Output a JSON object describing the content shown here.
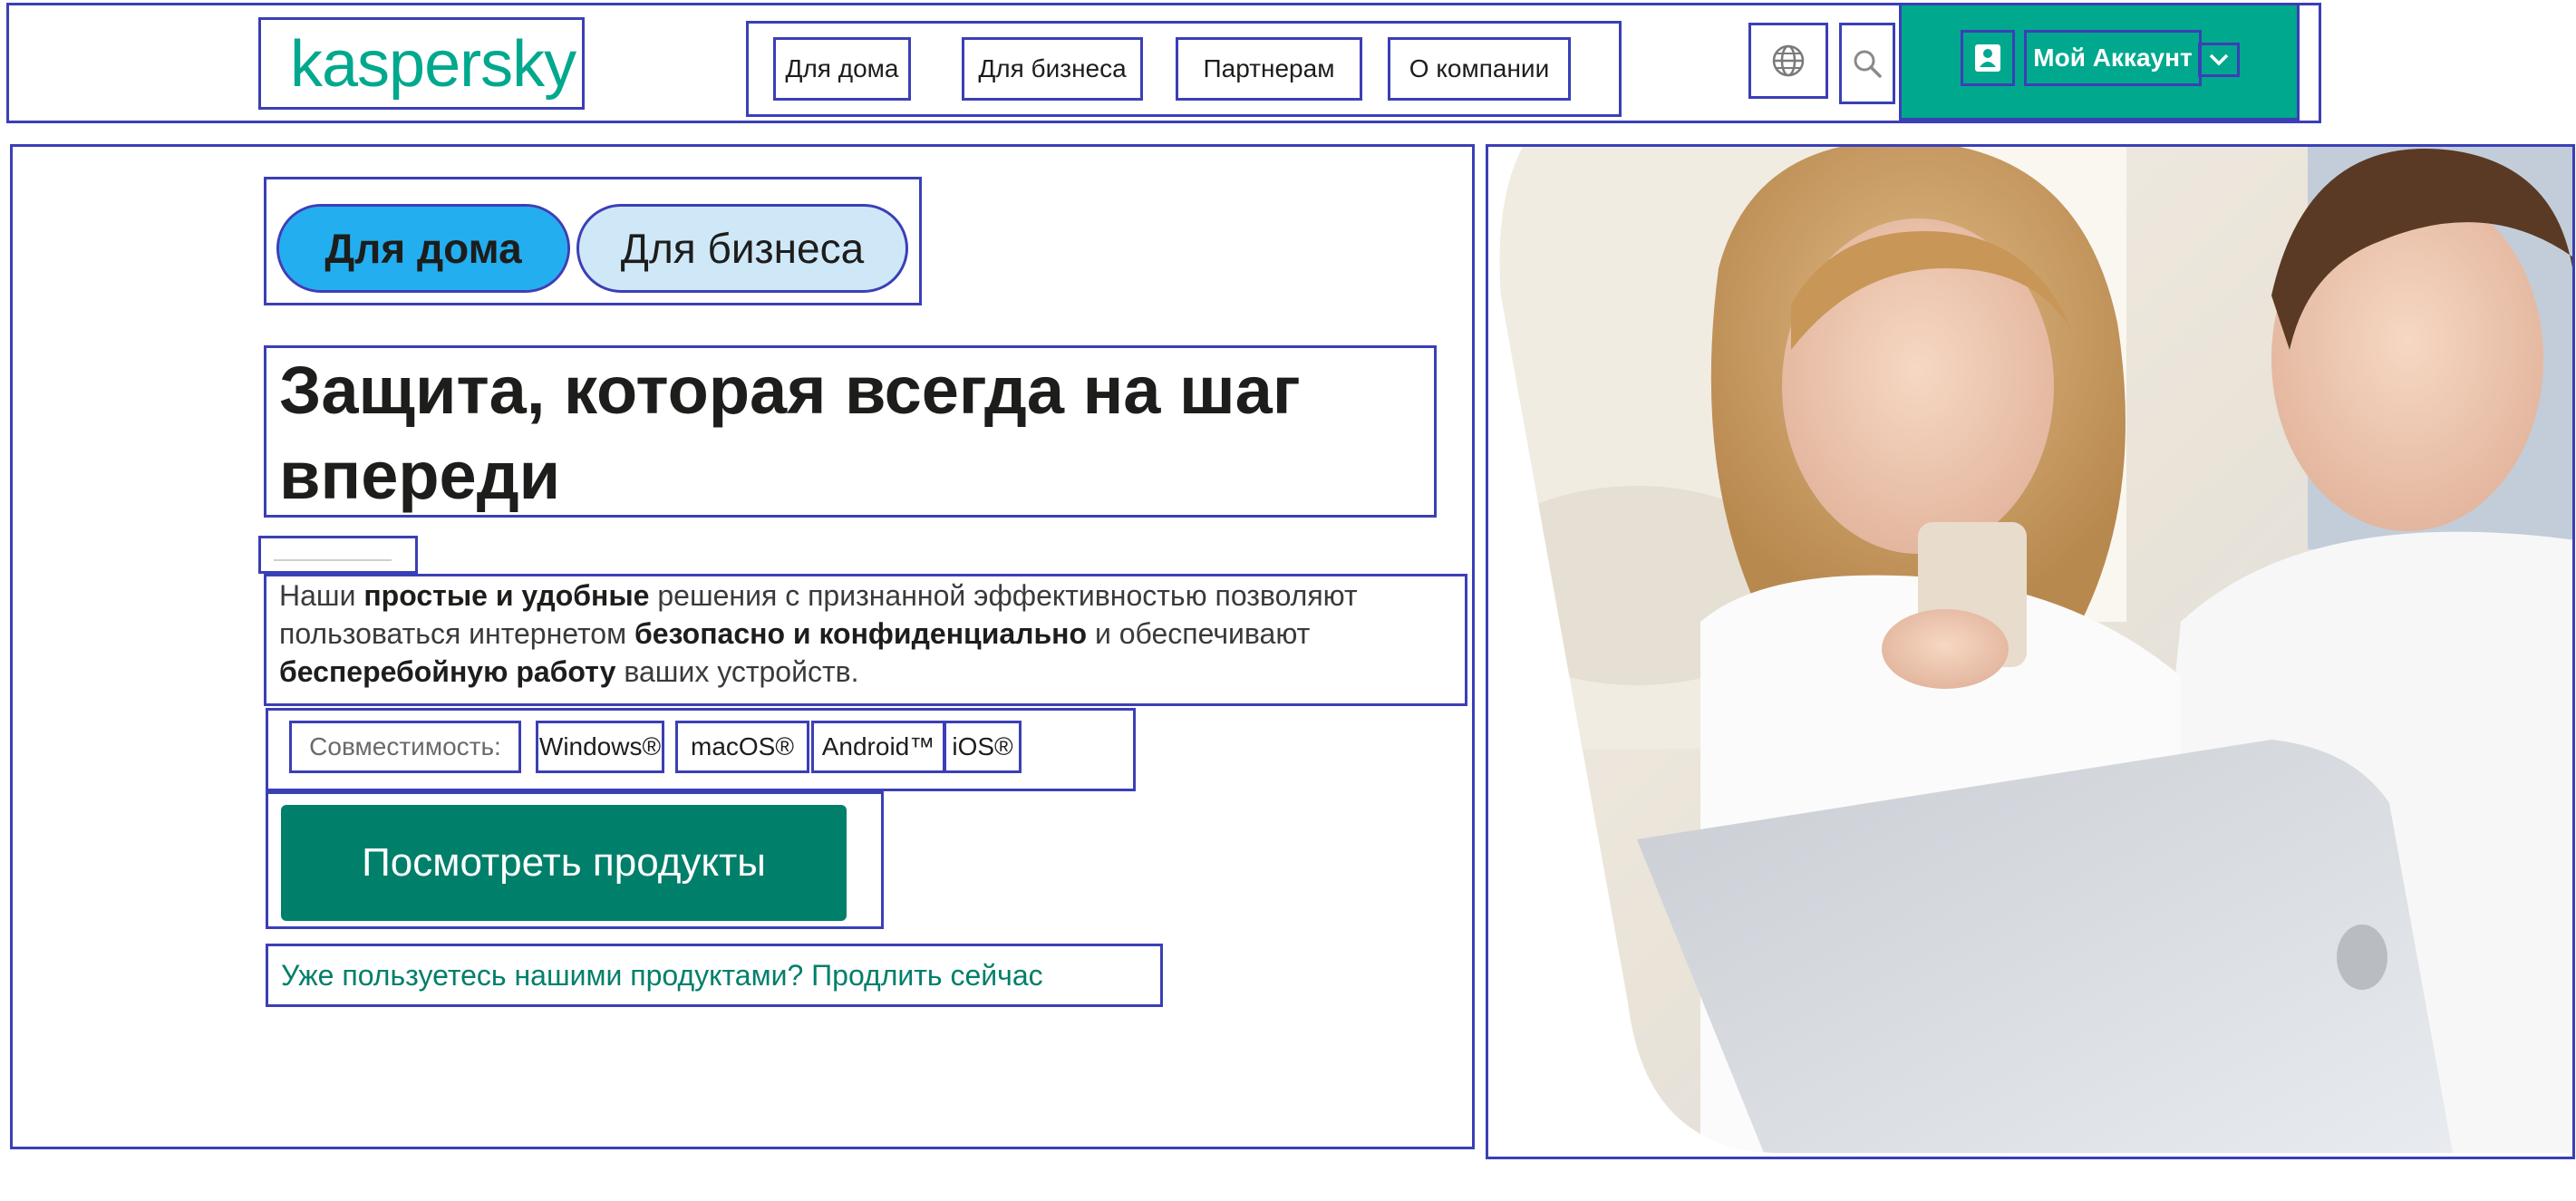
{
  "header": {
    "logo_text": "kaspersky",
    "nav": [
      "Для дома",
      "Для бизнеса",
      "Партнерам",
      "О компании"
    ],
    "account_label": "Мой Аккаунт",
    "icons": {
      "language": "globe-icon",
      "search": "search-icon",
      "account": "user-icon",
      "dropdown": "chevron-down-icon"
    }
  },
  "hero": {
    "segment": {
      "home": "Для дома",
      "business": "Для бизнеса",
      "active": "home"
    },
    "headline": "Защита, которая всегда на шаг впереди",
    "description": [
      {
        "text": "Наши ",
        "bold": false
      },
      {
        "text": "простые и удобные",
        "bold": true
      },
      {
        "text": " решения с признанной эффективностью позволяют пользоваться интернетом ",
        "bold": false
      },
      {
        "text": "безопасно и конфиденциально",
        "bold": true
      },
      {
        "text": " и обеспечивают ",
        "bold": false
      },
      {
        "text": "бесперебойную работу",
        "bold": true
      },
      {
        "text": " ваших устройств.",
        "bold": false
      }
    ],
    "compat_label": "Совместимость:",
    "platforms": [
      "Windows®",
      "macOS®",
      "Android™",
      "iOS®"
    ],
    "cta": "Посмотреть продукты",
    "renew_link": "Уже пользуетесь нашими продуктами? Продлить сейчас"
  },
  "colors": {
    "brand": "#00a88e",
    "cta": "#007f6a",
    "segment_active": "#23aef0",
    "segment_inactive": "#cfe8f8",
    "annotation_outline": "#3b3fb6"
  }
}
